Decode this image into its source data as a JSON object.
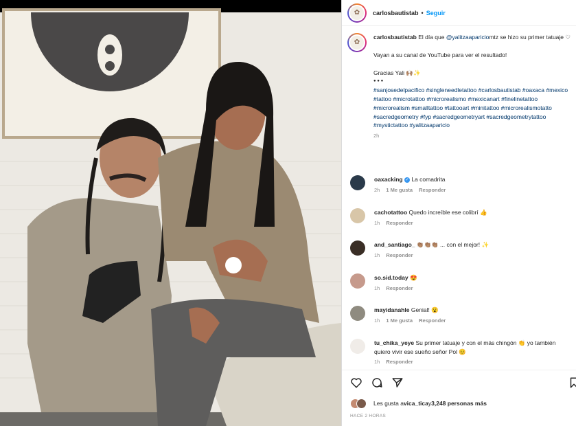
{
  "post": {
    "username": "carlosbautistab",
    "follow_label": "Seguir",
    "caption": {
      "line1_before": "El día que ",
      "mention": "@yalitzaaparicio",
      "mention_rest": "mtz",
      "line1_after": " se hizo su primer tatuaje ♡",
      "line2": "Vayan a su canal de YouTube para ver el resultado!",
      "line3": "Gracias Yali 🙌🏽✨",
      "dots": "● ● ●",
      "hashtags": "#sanjosedelpacifico #singleneedletattoo #carlosbautistab #oaxaca #mexico #tattoo #microtattoo #microrealismo #mexicanart #finelinetattoo #microrealism #smalltattoo #tattooart #minitattoo #microrealismotatto #sacredgeometry #fyp #sacredgeometryart #sacredgeometrytattoo #mystictattoo #yalitzaaparicio",
      "time": "2h"
    },
    "comments": [
      {
        "user": "oaxacking",
        "text": "La comadrita",
        "time": "2h",
        "likes": "1 Me gusta",
        "reply": "Responder",
        "verified": true
      },
      {
        "user": "cachotattoo",
        "text": "Quedo increíble ese colibrí 👍",
        "time": "1h",
        "likes": "",
        "reply": "Responder"
      },
      {
        "user": "and_santiago_",
        "text": "👏🏽👏🏽👏🏽 ... con el mejor! ✨",
        "time": "1h",
        "likes": "",
        "reply": "Responder"
      },
      {
        "user": "so.sid.today",
        "text": "😍",
        "time": "1h",
        "likes": "",
        "reply": "Responder"
      },
      {
        "user": "mayidanahle",
        "text": "Genial! 😮",
        "time": "1h",
        "likes": "1 Me gusta",
        "reply": "Responder"
      },
      {
        "user": "tu_chika_yeye",
        "text": "Su primer tatuaje y con el más chingón 👏 yo también quiero vivir ese sueño señor Pol 😊",
        "time": "1h",
        "likes": "",
        "reply": "Responder"
      }
    ],
    "likes_prefix": "Les gusta a ",
    "likes_user": "vica_tica",
    "likes_mid": " y ",
    "likes_count": "3,248 personas más",
    "ago": "HACE 2 HORAS"
  },
  "colors": {
    "link": "#00376b",
    "follow": "#0095f6",
    "muted": "#8e8e8e"
  }
}
